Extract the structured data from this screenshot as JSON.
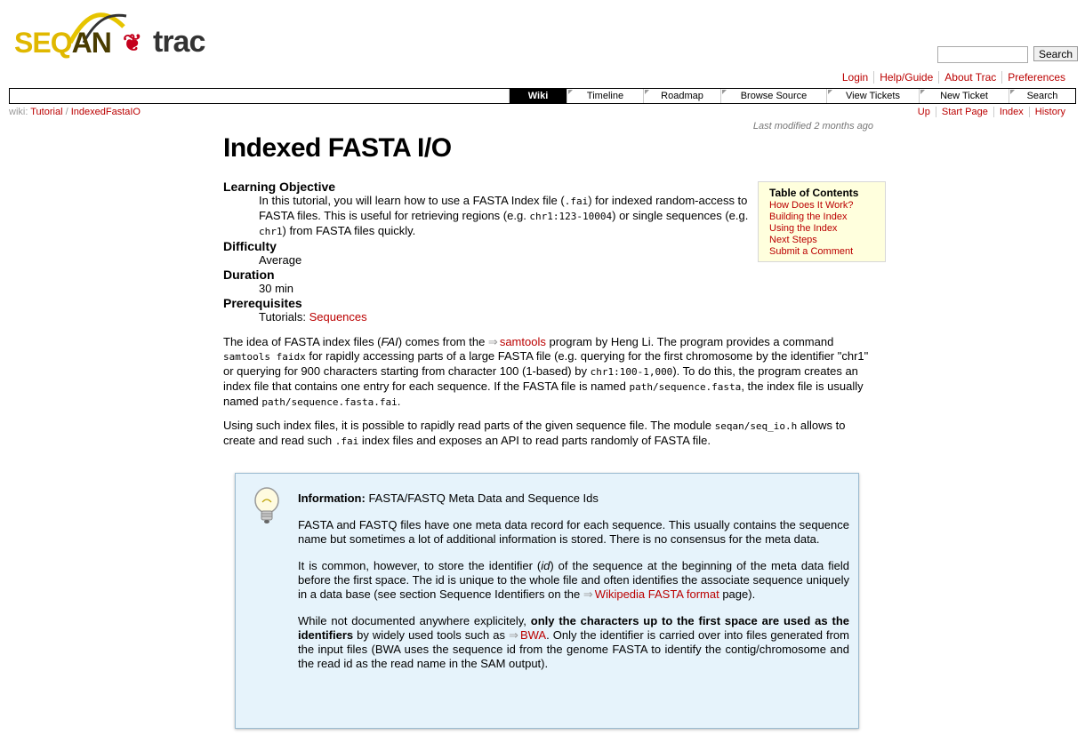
{
  "logo": {
    "seqan_a": "SEQ",
    "seqan_b": "AN",
    "trac": "trac",
    "paw": "❦"
  },
  "search": {
    "placeholder": "",
    "button": "Search"
  },
  "metanav": [
    "Login",
    "Help/Guide",
    "About Trac",
    "Preferences"
  ],
  "mainnav": [
    {
      "label": "Wiki",
      "active": true
    },
    {
      "label": "Timeline"
    },
    {
      "label": "Roadmap"
    },
    {
      "label": "Browse Source"
    },
    {
      "label": "View Tickets"
    },
    {
      "label": "New Ticket"
    },
    {
      "label": "Search"
    }
  ],
  "breadcrumb": {
    "prefix": "wiki:",
    "items": [
      "Tutorial",
      "IndexedFastaIO"
    ],
    "sep": "/"
  },
  "ctxtnav": [
    "Up",
    "Start Page",
    "Index",
    "History"
  ],
  "last_modified": {
    "prefix": "Last modified",
    "when": "2 months ago"
  },
  "page": {
    "title": "Indexed FASTA I/O",
    "definitions": [
      {
        "term": "Learning Objective"
      },
      {
        "term": "Difficulty",
        "desc": "Average"
      },
      {
        "term": "Duration",
        "desc": "30 min"
      },
      {
        "term": "Prerequisites",
        "desc_prefix": "Tutorials: ",
        "link": "Sequences"
      }
    ],
    "objective": {
      "t1": "In this tutorial, you will learn how to use a FASTA Index file (",
      "c1": ".fai",
      "t2": ") for indexed random-access to FASTA files. This is useful for retrieving regions (e.g. ",
      "c2": "chr1:123-10004",
      "t3": ") or single sequences (e.g. ",
      "c3": "chr1",
      "t4": ") from FASTA files quickly."
    },
    "para1": {
      "t1": "The idea of FASTA index files (",
      "em": "FAI",
      "t2": ") comes from the ",
      "link": "samtools",
      "t3": " program by Heng Li. The program provides a command ",
      "c1": "samtools faidx",
      "t4": " for rapidly accessing parts of a large FASTA file (e.g. querying for the first chromosome by the identifier \"chr1\" or querying for 900 characters starting from character 100 (1-based) by ",
      "c2": "chr1:100-1,000",
      "t5": "). To do this, the program creates an index file that contains one entry for each sequence. If the FASTA file is named ",
      "c3": "path/sequence.fasta",
      "t6": ", the index file is usually named ",
      "c4": "path/sequence.fasta.fai",
      "t7": "."
    },
    "para2": {
      "t1": "Using such index files, it is possible to rapidly read parts of the given sequence file. The module ",
      "c1": "seqan/seq_io.h",
      "t2": " allows to create and read such ",
      "c2": ".fai",
      "t3": " index files and exposes an API to read parts randomly of FASTA file."
    }
  },
  "toc": {
    "title": "Table of Contents",
    "items": [
      "How Does It Work?",
      "Building the Index",
      "Using the Index",
      "Next Steps",
      "Submit a Comment"
    ]
  },
  "info": {
    "label": "Information:",
    "heading": " FASTA/FASTQ Meta Data and Sequence Ids",
    "p1": "FASTA and FASTQ files have one meta data record for each sequence. This usually contains the sequence name but sometimes a lot of additional information is stored. There is no consensus for the meta data.",
    "p2": {
      "t1": "It is common, however, to store the identifier (",
      "em": "id",
      "t2": ") of the sequence at the beginning of the meta data field before the first space. The id is unique to the whole file and often identifies the associate sequence uniquely in a data base (see section Sequence Identifiers on the ",
      "link": "Wikipedia FASTA format",
      "t3": " page)."
    },
    "p3": {
      "t1": "While not documented anywhere explicitely, ",
      "strong": "only the characters up to the first space are used as the identifiers",
      "t2": " by widely used tools such as ",
      "link": "BWA",
      "t3": ". Only the identifier is carried over into files generated from the input files (BWA uses the sequence id from the genome FASTA to identify the contig/chromosome and the read id as the read name in the SAM output)."
    }
  }
}
